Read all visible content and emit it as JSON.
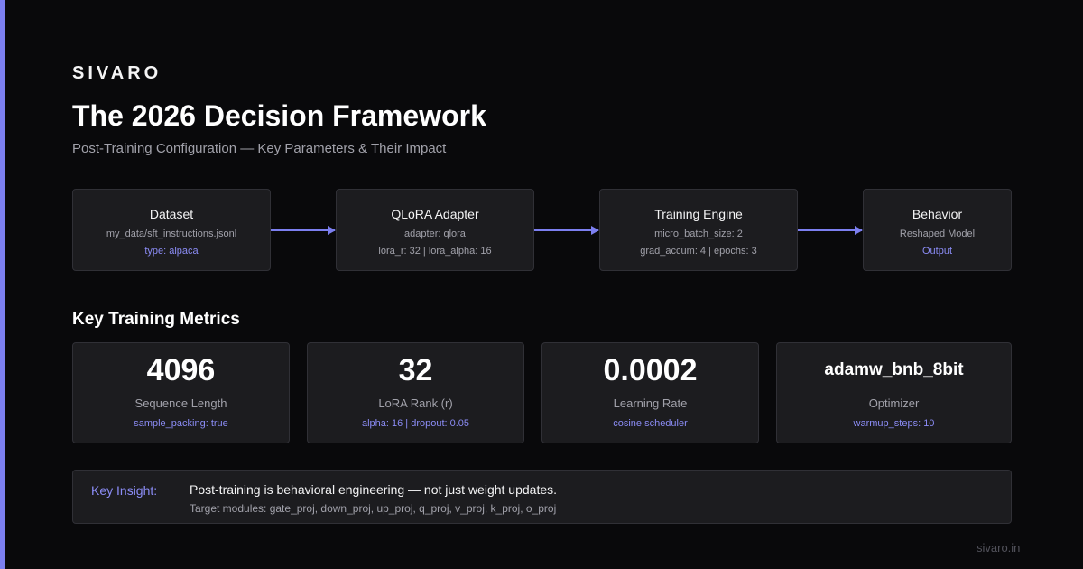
{
  "brand": "SIVARO",
  "title": "The 2026 Decision Framework",
  "subtitle": "Post-Training Configuration — Key Parameters & Their Impact",
  "colors": {
    "accent": "#7c7ff0",
    "background": "#09090b",
    "card": "#1c1c1f",
    "border": "#303036"
  },
  "pipeline": [
    {
      "title": "Dataset",
      "line1": "my_data/sft_instructions.jsonl",
      "line2": "type: alpaca",
      "line2_accent": true
    },
    {
      "title": "QLoRA Adapter",
      "line1": "adapter: qlora",
      "line2": "lora_r: 32 | lora_alpha: 16",
      "line2_accent": false
    },
    {
      "title": "Training Engine",
      "line1": "micro_batch_size: 2",
      "line2": "grad_accum: 4 | epochs: 3",
      "line2_accent": false
    },
    {
      "title": "Behavior",
      "line1": "Reshaped Model",
      "line2": "Output",
      "line2_accent": true
    }
  ],
  "metrics_title": "Key Training Metrics",
  "metrics": [
    {
      "value": "4096",
      "label": "Sequence Length",
      "sub": "sample_packing: true"
    },
    {
      "value": "32",
      "label": "LoRA Rank (r)",
      "sub": "alpha: 16 | dropout: 0.05"
    },
    {
      "value": "0.0002",
      "label": "Learning Rate",
      "sub": "cosine scheduler"
    },
    {
      "value": "adamw_bnb_8bit",
      "label": "Optimizer",
      "sub": "warmup_steps: 10"
    }
  ],
  "insight": {
    "label": "Key Insight:",
    "main": "Post-training is behavioral engineering — not just weight updates.",
    "sub": "Target modules: gate_proj, down_proj, up_proj, q_proj, v_proj, k_proj, o_proj"
  },
  "footer": "sivaro.in"
}
